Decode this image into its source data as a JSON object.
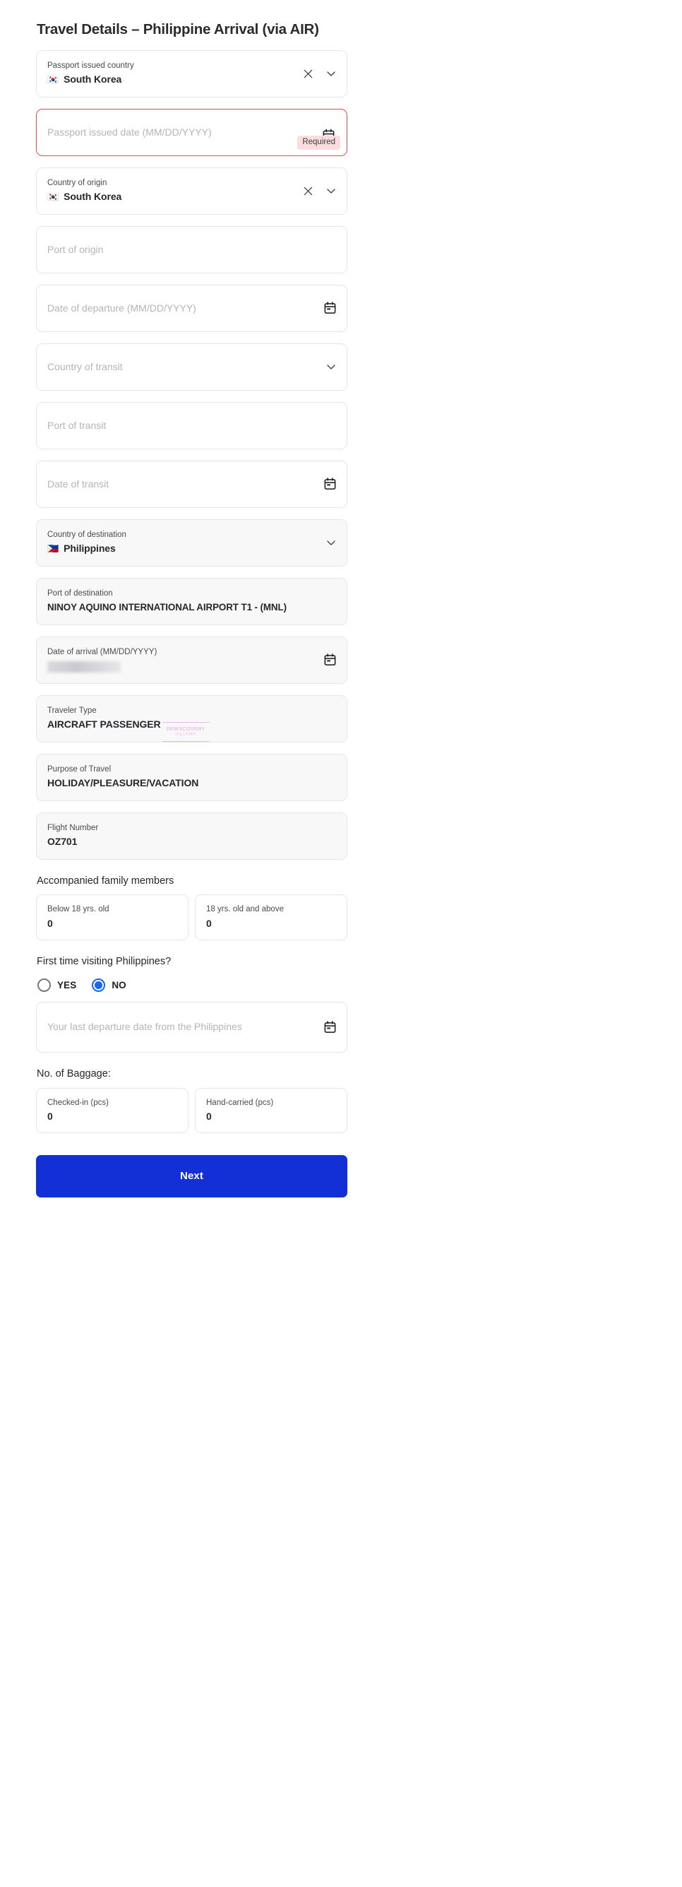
{
  "page": {
    "title": "Travel Details – Philippine Arrival (via AIR)"
  },
  "watermark": {
    "main": "DEWSCOVERY",
    "sub": "©듀스커버리"
  },
  "fields": {
    "passport_country": {
      "label": "Passport issued country",
      "flag": "🇰🇷",
      "value": "South Korea"
    },
    "passport_date": {
      "placeholder": "Passport issued date (MM/DD/YYYY)",
      "badge": "Required"
    },
    "country_origin": {
      "label": "Country of origin",
      "flag": "🇰🇷",
      "value": "South Korea"
    },
    "port_origin": {
      "placeholder": "Port of origin"
    },
    "date_departure": {
      "placeholder": "Date of departure (MM/DD/YYYY)"
    },
    "country_transit": {
      "placeholder": "Country of transit"
    },
    "port_transit": {
      "placeholder": "Port of transit"
    },
    "date_transit": {
      "placeholder": "Date of transit"
    },
    "country_destination": {
      "label": "Country of destination",
      "flag": "🇵🇭",
      "value": "Philippines"
    },
    "port_destination": {
      "label": "Port of destination",
      "value": "NINOY AQUINO INTERNATIONAL AIRPORT T1 - (MNL)"
    },
    "date_arrival": {
      "label": "Date of arrival (MM/DD/YYYY)",
      "value": ""
    },
    "traveler_type": {
      "label": "Traveler Type",
      "value": "AIRCRAFT PASSENGER"
    },
    "purpose": {
      "label": "Purpose of Travel",
      "value": "HOLIDAY/PLEASURE/VACATION"
    },
    "flight_number": {
      "label": "Flight Number",
      "value": "OZ701"
    },
    "last_departure": {
      "placeholder": "Your last departure date from the Philippines"
    }
  },
  "family": {
    "heading": "Accompanied family members",
    "below18": {
      "label": "Below 18 yrs. old",
      "value": "0"
    },
    "above18": {
      "label": "18 yrs. old and above",
      "value": "0"
    }
  },
  "first_visit": {
    "question": "First time visiting Philippines?",
    "yes_label": "YES",
    "no_label": "NO",
    "selected": "NO"
  },
  "baggage": {
    "heading": "No. of Baggage:",
    "checked_in": {
      "label": "Checked-in (pcs)",
      "value": "0"
    },
    "hand_carried": {
      "label": "Hand-carried (pcs)",
      "value": "0"
    }
  },
  "submit": {
    "label": "Next"
  },
  "colors": {
    "accent": "#1330d6",
    "radio_selected": "#1766f0",
    "error_border": "#ea4b4b",
    "required_badge_bg": "#fcdcdc"
  }
}
